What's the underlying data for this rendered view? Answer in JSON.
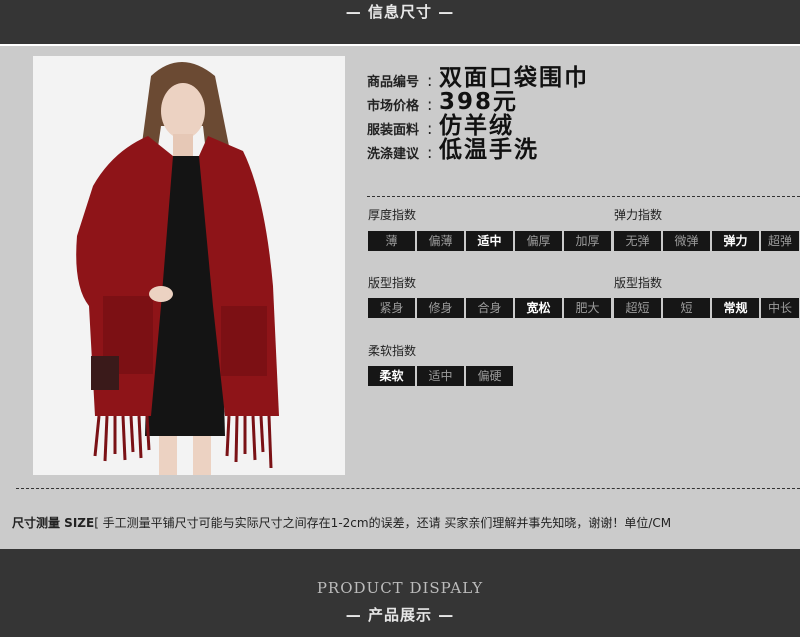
{
  "header": {
    "title": "— 信息尺寸 —"
  },
  "product": {
    "rows": [
      {
        "label": "商品编号",
        "colon": ":",
        "value": "双面口袋围巾"
      },
      {
        "label": "市场价格",
        "colon": ":",
        "value": "398元"
      },
      {
        "label": "服装面料",
        "colon": ":",
        "value": "仿羊绒"
      },
      {
        "label": "洗涤建议",
        "colon": ":",
        "value": "低温手洗"
      }
    ]
  },
  "scales": {
    "thickness": {
      "label": "厚度指数",
      "options": [
        "薄",
        "偏薄",
        "适中",
        "偏厚",
        "加厚"
      ],
      "selected": "适中"
    },
    "elasticity": {
      "label": "弹力指数",
      "options": [
        "无弹",
        "微弹",
        "弹力",
        "超弹"
      ],
      "selected": "弹力"
    },
    "fit": {
      "label": "版型指数",
      "options": [
        "紧身",
        "修身",
        "合身",
        "宽松",
        "肥大"
      ],
      "selected": "宽松"
    },
    "length": {
      "label": "版型指数",
      "options": [
        "超短",
        "短",
        "常规",
        "中长"
      ],
      "selected": "常规"
    },
    "softness": {
      "label": "柔软指数",
      "options": [
        "柔软",
        "适中",
        "偏硬"
      ],
      "selected": "柔软"
    }
  },
  "footnote": {
    "title": "尺寸测量 SIZE",
    "text": "[ 手工测量平铺尺寸可能与实际尺寸之间存在1-2cm的误差，还请 买家亲们理解并事先知晓，谢谢！单位/CM"
  },
  "footer": {
    "english": "PRODUCT DISPALY",
    "chinese": "— 产品展示 —"
  },
  "colors": {
    "scarf": "#8e1418",
    "cell_bg": "#161616",
    "bar_bg": "#353535"
  }
}
